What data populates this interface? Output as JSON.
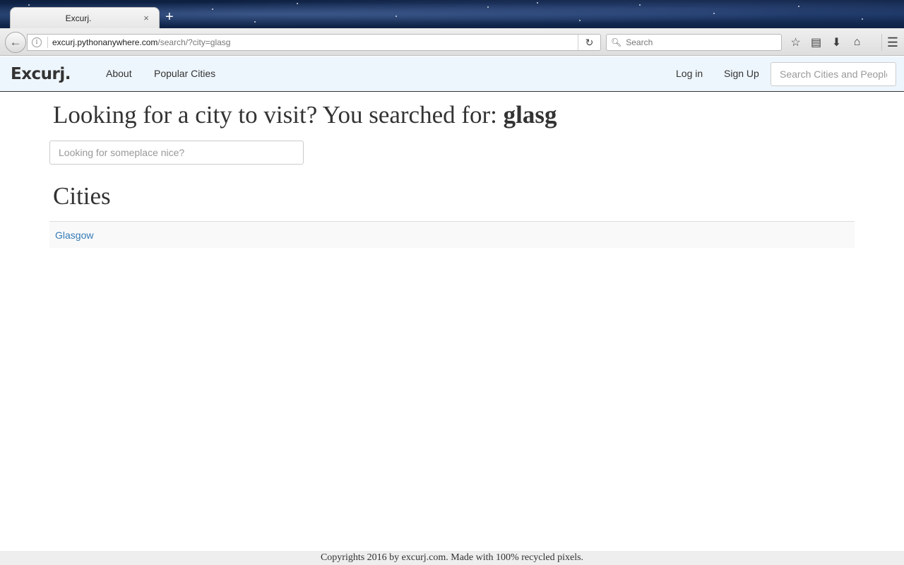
{
  "browser": {
    "tab_title": "Excurj.",
    "tab_close": "×",
    "new_tab": "+",
    "url_host": "excurj.pythonanywhere.com",
    "url_path": "/search/?city=glasg",
    "search_placeholder": "Search",
    "back_icon": "arrow-left-icon",
    "reload_icon": "reload-icon",
    "toolbar_icons": [
      "bookmark-star-icon",
      "reading-list-icon",
      "download-icon",
      "home-icon"
    ],
    "menu_icon": "hamburger-menu-icon"
  },
  "site_nav": {
    "brand": "Excurj.",
    "links": [
      "About",
      "Popular Cities"
    ],
    "login": "Log in",
    "signup": "Sign Up",
    "search_placeholder": "Search Cities and People"
  },
  "main": {
    "title_prefix": "Looking for a city to visit? You searched for: ",
    "query": "glasg",
    "city_input_placeholder": "Looking for someplace nice?",
    "section_title": "Cities",
    "results": [
      "Glasgow"
    ]
  },
  "footer": {
    "text": "Copyrights 2016 by excurj.com. Made with 100% recycled pixels."
  },
  "colors": {
    "nav_bg": "#eef6fd",
    "link": "#337ab7",
    "text": "#333333",
    "row_bg": "#f9f9f9"
  }
}
